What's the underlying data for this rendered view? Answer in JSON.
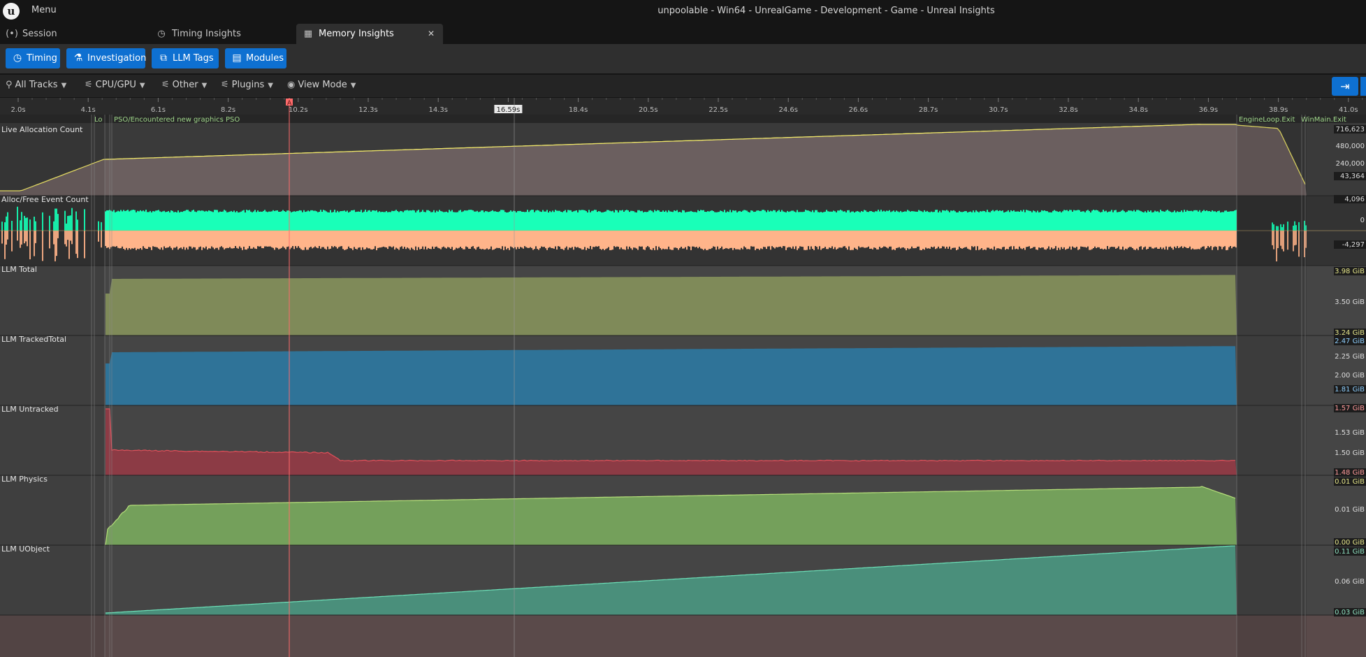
{
  "app": {
    "logo_letter": "u",
    "menu_label": "Menu",
    "window_title": "unpoolable - Win64 - UnrealGame - Development - Game - Unreal Insights"
  },
  "tabs": [
    {
      "label": "Session",
      "icon": "broadcast-icon",
      "glyph": "(•)"
    },
    {
      "label": "Timing Insights",
      "icon": "clock-icon",
      "glyph": "◷"
    },
    {
      "label": "Memory Insights",
      "icon": "memory-chip-icon",
      "glyph": "▦",
      "active": true
    }
  ],
  "toolbar": {
    "timing": "Timing",
    "investigation": "Investigation",
    "llm_tags": "LLM Tags",
    "modules": "Modules"
  },
  "filters": {
    "all_tracks": "All Tracks",
    "cpu_gpu": "CPU/GPU",
    "other": "Other",
    "plugins": "Plugins",
    "view_mode": "View Mode"
  },
  "colors": {
    "accent": "#0e70d1",
    "marker": "#ff6b6b",
    "live_alloc": "#6b5f5f",
    "live_alloc_line": "#f2e96a",
    "alloc_event": "#19ffb8",
    "free_event": "#ffb48a",
    "llm_total": "#7f8a59",
    "llm_tracked": "#2f7398",
    "llm_untracked": "#8c3b45",
    "llm_physics": "#74a05b",
    "llm_uobject": "#4a8f7b"
  },
  "timeline": {
    "ticks": [
      "2.0s",
      "4.1s",
      "6.1s",
      "8.2s",
      "10.2s",
      "12.3s",
      "14.3s",
      "16.59s",
      "18.4s",
      "20.5s",
      "22.5s",
      "24.6s",
      "26.6s",
      "28.7s",
      "30.7s",
      "32.8s",
      "34.8s",
      "36.9s",
      "38.9s",
      "41.0s"
    ],
    "marker_label": "A",
    "cursor_time": "16.59s",
    "events": {
      "lo": "Lo",
      "pso": "PSO/Encountered new graphics PSO",
      "engine_loop_exit": "EngineLoop.Exit",
      "winmain_exit": "WinMain.Exit"
    }
  },
  "tracks": [
    {
      "name": "Live Allocation Count",
      "labels": [
        "716,623",
        "480,000",
        "240,000",
        "43,364"
      ]
    },
    {
      "name": "Alloc/Free Event Count",
      "labels": [
        "4,096",
        "0",
        "-4,297"
      ]
    },
    {
      "name": "LLM Total",
      "labels": [
        "3.98 GiB",
        "3.50 GiB",
        "3.24 GiB"
      ]
    },
    {
      "name": "LLM TrackedTotal",
      "labels": [
        "2.47 GiB",
        "2.25 GiB",
        "2.00 GiB",
        "1.81 GiB"
      ]
    },
    {
      "name": "LLM Untracked",
      "labels": [
        "1.57 GiB",
        "1.53 GiB",
        "1.50 GiB",
        "1.48 GiB"
      ]
    },
    {
      "name": "LLM Physics",
      "labels": [
        "0.01 GiB",
        "0.01 GiB",
        "0.00 GiB"
      ]
    },
    {
      "name": "LLM UObject",
      "labels": [
        "0.11 GiB",
        "0.06 GiB",
        "0.03 GiB"
      ]
    }
  ]
}
